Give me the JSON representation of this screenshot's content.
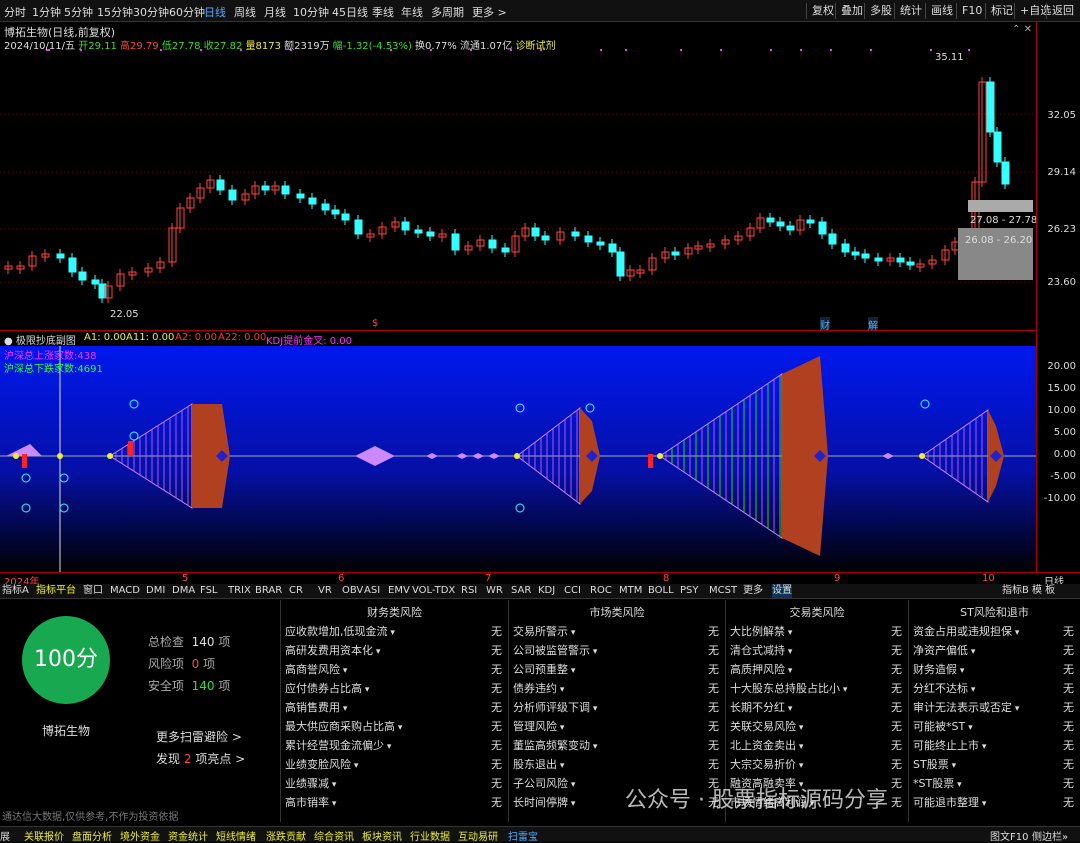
{
  "topbar": {
    "tabs": [
      "分时",
      "1分钟",
      "5分钟",
      "15分钟",
      "30分钟",
      "60分钟",
      "日线",
      "周线",
      "月线",
      "10分钟",
      "45日线",
      "季线",
      "年线",
      "多周期",
      "更多 >"
    ],
    "active": "日线",
    "right": [
      "复权",
      "叠加",
      "多股",
      "统计",
      "画线",
      "F10",
      "标记",
      "+自选",
      "返回"
    ]
  },
  "stock": {
    "title": "博拓生物(日线,前复权)",
    "info_date": "2024/10/11/五",
    "open": "开29.11",
    "high": "高29.79",
    "low": "低27.78",
    "close": "收27.82",
    "vol": "量8173",
    "amt": "额2319万",
    "chg": "幅-1.32(-4.53%)",
    "turn": "换0.77%",
    "float": "流通1.07亿",
    "diag": "诊断试剂"
  },
  "price_axis": [
    "32.05",
    "29.14",
    "26.23",
    "23.60"
  ],
  "annotations": {
    "high": "35.11",
    "low": "22.05",
    "box1": "27.08 - 27.78",
    "box2": "26.08 - 26.20",
    "mark_s": "$",
    "mark_cai": "财",
    "mark_jie": "解"
  },
  "indicator": {
    "name": "极限抄底副图",
    "a1": "A1: 0.00",
    "a11": "A11: 0.00",
    "a2": "A2: 0.00",
    "a22": "A22: 0.00",
    "kdj": "KDJ提前金叉: 0.00",
    "up": "沪深总上涨家数:438",
    "down": "沪深总下跌家数:4691",
    "axis": [
      "20.00",
      "15.00",
      "10.00",
      "5.00",
      "0.00",
      "-5.00",
      "-10.00"
    ]
  },
  "dates": [
    "2024年",
    "5",
    "6",
    "7",
    "8",
    "9",
    "10"
  ],
  "datebar_right": "日线",
  "ind_tabs": [
    "指标A",
    "指标平台",
    "窗口",
    "MACD",
    "DMI",
    "DMA",
    "FSL",
    "TRIX",
    "BRAR",
    "CR",
    "VR",
    "OBV",
    "ASI",
    "EMV",
    "VOL-TDX",
    "RSI",
    "WR",
    "SAR",
    "KDJ",
    "CCI",
    "ROC",
    "MTM",
    "BOLL",
    "PSY",
    "MCST",
    "更多",
    "设置"
  ],
  "ind_tabs_right": [
    "指标B",
    "模 板"
  ],
  "panel": {
    "score": "100分",
    "check": "总检查",
    "check_n": "140",
    "risk": "风险项",
    "risk_n": "0",
    "safe": "安全项",
    "safe_n": "140",
    "unit": "项",
    "name": "博拓生物",
    "more": "更多扫雷避险 >",
    "found_a": "发现",
    "found_n": "2",
    "found_b": "项亮点 >",
    "disclaimer": "通达信大数据,仅供参考,不作为投资依据",
    "cols": [
      {
        "title": "财务类风险",
        "items": [
          "应收款增加,低现金流",
          "高研发费用资本化",
          "高商誉风险",
          "应付债券占比高",
          "高销售费用",
          "最大供应商采购占比高",
          "累计经营现金流偏少",
          "业绩变脸风险",
          "业绩骤减",
          "高市销率"
        ]
      },
      {
        "title": "市场类风险",
        "items": [
          "交易所警示",
          "公司被监管警示",
          "公司预重整",
          "债券违约",
          "分析师评级下调",
          "管理风险",
          "董监高频繁变动",
          "股东退出",
          "子公司风险",
          "长时间停牌"
        ]
      },
      {
        "title": "交易类风险",
        "items": [
          "大比例解禁",
          "清仓式减持",
          "高质押风险",
          "十大股东总持股占比小",
          "长期不分红",
          "关联交易风险",
          "北上资金卖出",
          "大宗交易折价",
          "融资高融卖率",
          "市场情绪高利润"
        ]
      },
      {
        "title": "ST风险和退市",
        "items": [
          "资金占用或违规担保",
          "净资产偏低",
          "财务造假",
          "分红不达标",
          "审计无法表示或否定",
          "可能被*ST",
          "可能终止上市",
          "ST股票",
          "*ST股票",
          "可能退市整理"
        ]
      }
    ],
    "none": "无"
  },
  "watermark": "公众号 · 股票指标源码分享",
  "bottom": [
    "展",
    "关联报价",
    "盘面分析",
    "境外资金",
    "资金统计",
    "短线情绪",
    "涨跌贡献",
    "综合资讯",
    "板块资讯",
    "行业数据",
    "互动易研",
    "扫雷宝"
  ],
  "bottom_right": [
    "图文F10",
    "侧边栏»"
  ]
}
